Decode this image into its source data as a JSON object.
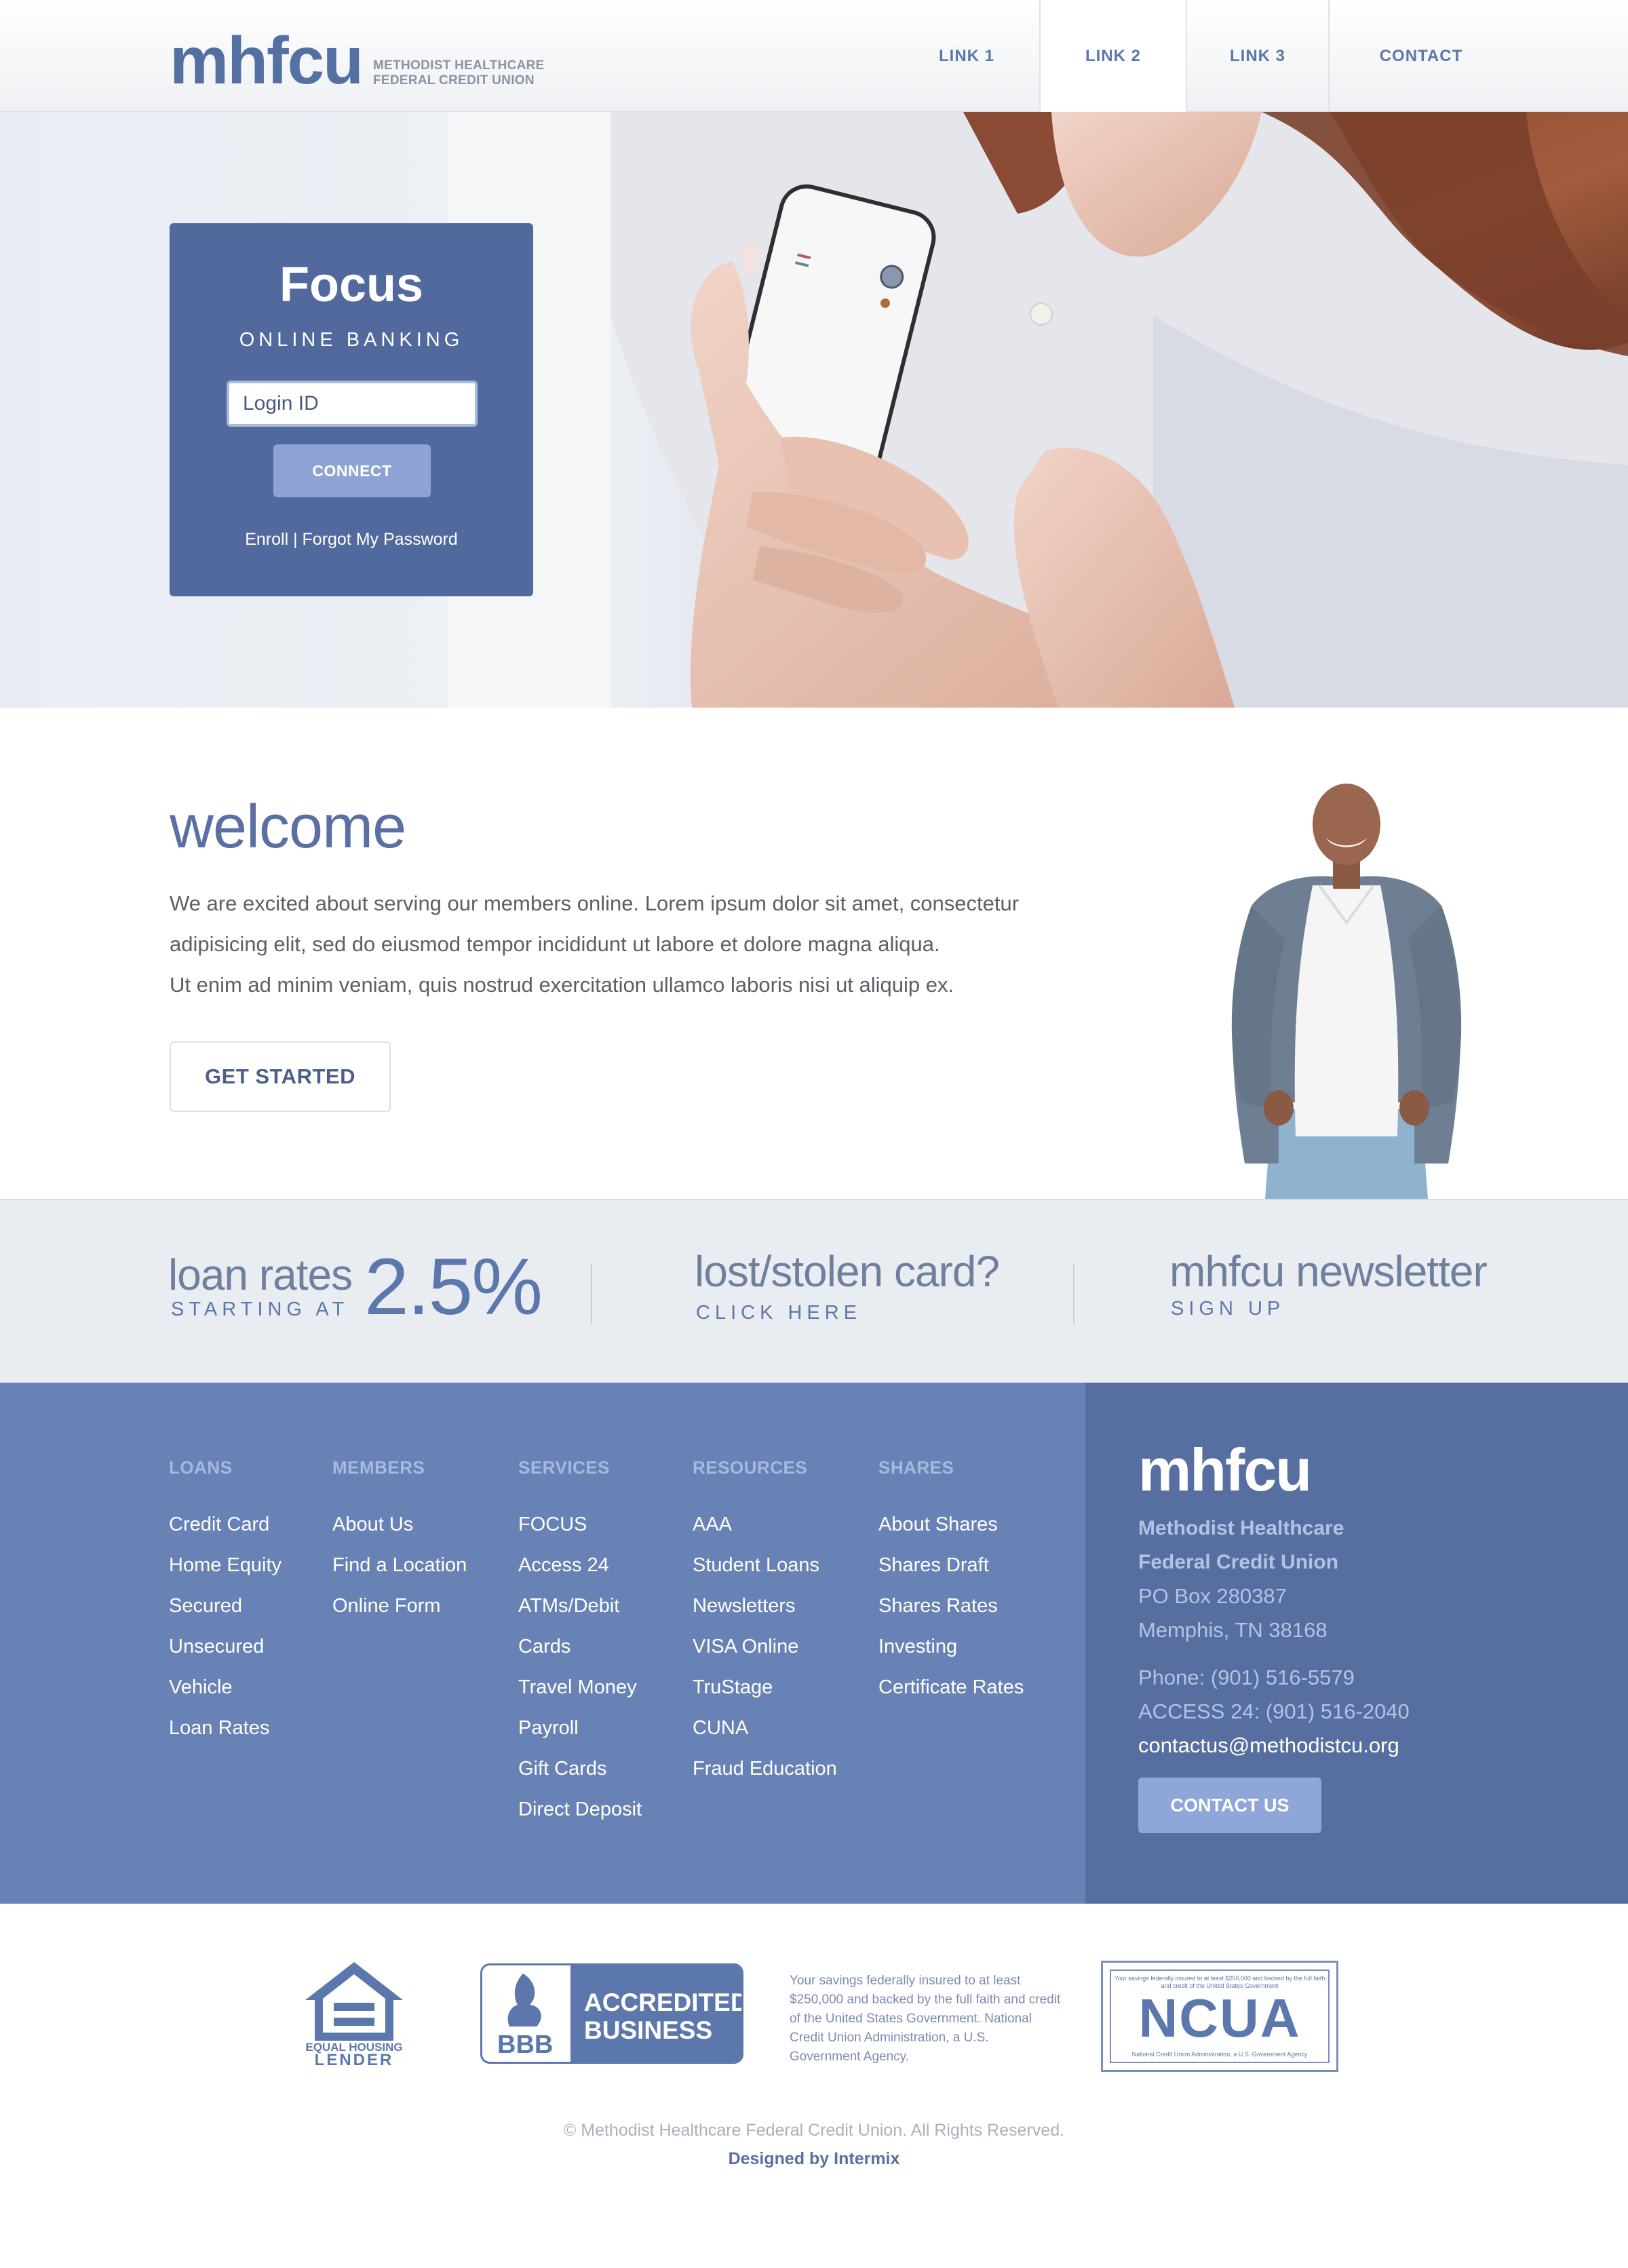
{
  "header": {
    "logo_word": "mhfcu",
    "logo_sub_line1": "METHODIST HEALTHCARE",
    "logo_sub_line2": "FEDERAL CREDIT UNION",
    "nav": [
      "LINK 1",
      "LINK 2",
      "LINK 3",
      "CONTACT"
    ]
  },
  "login": {
    "title": "Focus",
    "subtitle": "ONLINE BANKING",
    "input_placeholder": "Login ID",
    "button": "CONNECT",
    "links": "Enroll | Forgot My Password"
  },
  "welcome": {
    "title": "welcome",
    "lines": [
      "We are excited about serving our members online. Lorem ipsum dolor sit amet, consectetur",
      "adipisicing elit, sed do eiusmod tempor incididunt ut labore et dolore magna aliqua.",
      "Ut enim ad minim veniam, quis nostrud exercitation ullamco laboris nisi ut aliquip ex."
    ],
    "button": "GET STARTED"
  },
  "band": {
    "rates_title": "loan rates",
    "rates_sub": "STARTING AT",
    "rates_value": "2.5%",
    "card_title": "lost/stolen card?",
    "card_sub": "CLICK HERE",
    "news_title": "mhfcu newsletter",
    "news_sub": "SIGN UP"
  },
  "footer": {
    "columns": [
      {
        "head": "LOANS",
        "items": [
          "Credit Card",
          "Home Equity",
          "Secured",
          "Unsecured",
          "Vehicle",
          "Loan Rates"
        ]
      },
      {
        "head": "MEMBERS",
        "items": [
          "About Us",
          "Find a Location",
          "Online Form"
        ]
      },
      {
        "head": "SERVICES",
        "items": [
          "FOCUS",
          "Access 24",
          "ATMs/Debit",
          "Cards",
          "Travel Money",
          "Payroll",
          "Gift Cards",
          "Direct Deposit"
        ]
      },
      {
        "head": "RESOURCES",
        "items": [
          "AAA",
          "Student Loans",
          "Newsletters",
          "VISA Online",
          "TruStage",
          "CUNA",
          "Fraud Education"
        ]
      },
      {
        "head": "SHARES",
        "items": [
          "About Shares",
          "Shares Draft",
          "Shares Rates",
          "Investing",
          "Certificate Rates"
        ]
      }
    ],
    "logo": "mhfcu",
    "org_line1": "Methodist Healthcare",
    "org_line2": "Federal Credit Union",
    "addr_line1": "PO Box 280387",
    "addr_line2": "Memphis, TN 38168",
    "phone": "Phone: (901) 516-5579",
    "access": "ACCESS 24: (901) 516-2040",
    "email": "contactus@methodistcu.org",
    "contact_button": "CONTACT US"
  },
  "badges": {
    "ehl_line1": "EQUAL HOUSING",
    "ehl_line2": "LENDER",
    "bbb_line1": "ACCREDITED",
    "bbb_line2": "BUSINESS",
    "bbb_logo": "BBB",
    "fdic_text": "Your savings federally insured to at least $250,000 and backed by the full faith and credit of the United States Government. National Credit Union Administration, a U.S. Government Agency.",
    "ncua_top": "Your savings federally insured to at least $250,000 and backed by the full faith and credit of the United States Government",
    "ncua_word": "NCUA",
    "ncua_bottom": "National Credit Union Administration, a U.S. Government Agency"
  },
  "copyright": "© Methodist Healthcare Federal Credit Union. All Rights Reserved.",
  "designed_by": "Designed by Intermix",
  "colors": {
    "brand": "#5470a3",
    "accent": "#8da3d4",
    "footer": "#6982b5",
    "footer_dark": "#566ea0"
  }
}
